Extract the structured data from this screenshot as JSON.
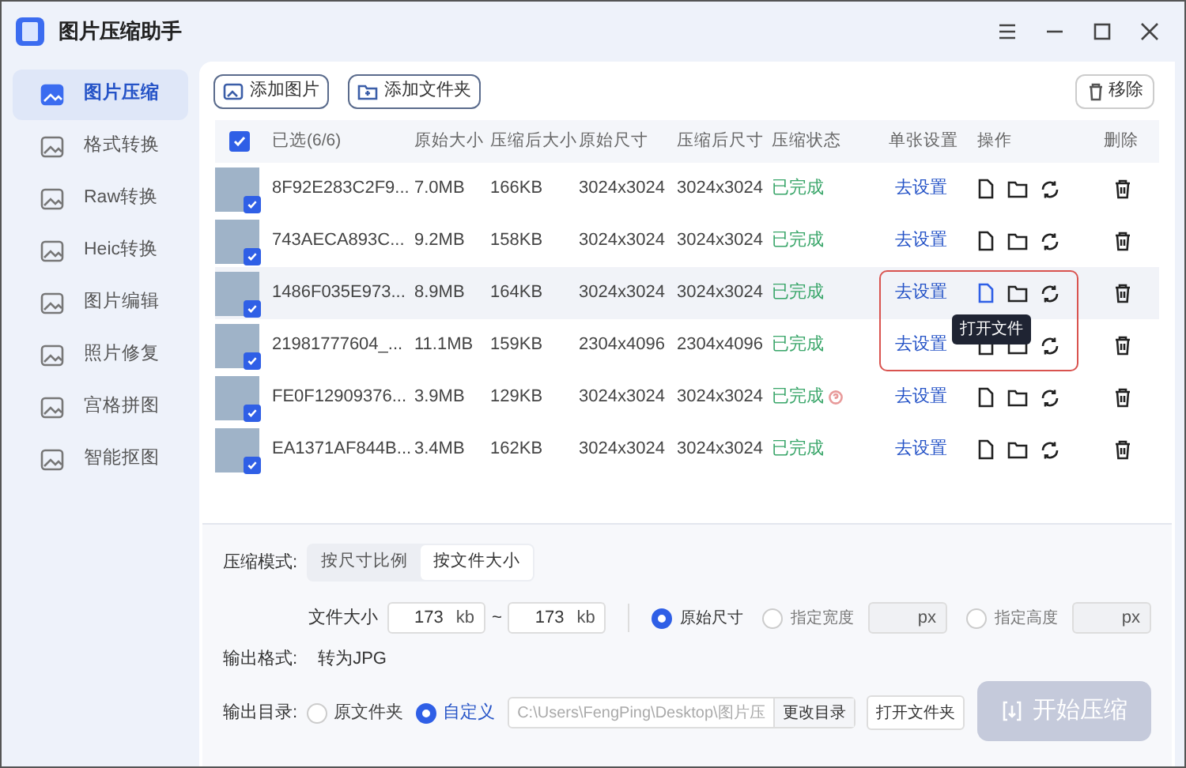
{
  "window": {
    "title": "图片压缩助手"
  },
  "sidebar": {
    "items": [
      {
        "label": "图片压缩",
        "selected": true
      },
      {
        "label": "格式转换",
        "selected": false
      },
      {
        "label": "Raw转换",
        "selected": false
      },
      {
        "label": "Heic转换",
        "selected": false
      },
      {
        "label": "图片编辑",
        "selected": false
      },
      {
        "label": "照片修复",
        "selected": false
      },
      {
        "label": "宫格拼图",
        "selected": false
      },
      {
        "label": "智能抠图",
        "selected": false
      }
    ]
  },
  "toolbar": {
    "add_image": "添加图片",
    "add_folder": "添加文件夹",
    "remove": "移除"
  },
  "table": {
    "all_checked": true,
    "columns": [
      "已选(6/6)",
      "原始大小",
      "压缩后大小",
      "原始尺寸",
      "压缩后尺寸",
      "压缩状态",
      "单张设置",
      "操作",
      "删除"
    ],
    "rows": [
      {
        "checked": true,
        "name": "8F92E283C2F9...",
        "original_size": "7.0MB",
        "compressed_size": "166KB",
        "original_dimensions": "3024x3024",
        "compressed_dimensions": "3024x3024",
        "status": "已完成",
        "status_info": false,
        "settings_link": "去设置",
        "hovered": false
      },
      {
        "checked": true,
        "name": "743AECA893C...",
        "original_size": "9.2MB",
        "compressed_size": "158KB",
        "original_dimensions": "3024x3024",
        "compressed_dimensions": "3024x3024",
        "status": "已完成",
        "status_info": false,
        "settings_link": "去设置",
        "hovered": false
      },
      {
        "checked": true,
        "name": "1486F035E973...",
        "original_size": "8.9MB",
        "compressed_size": "164KB",
        "original_dimensions": "3024x3024",
        "compressed_dimensions": "3024x3024",
        "status": "已完成",
        "status_info": false,
        "settings_link": "去设置",
        "hovered": true,
        "tooltip": "打开文件"
      },
      {
        "checked": true,
        "name": "21981777604_...",
        "original_size": "11.1MB",
        "compressed_size": "159KB",
        "original_dimensions": "2304x4096",
        "compressed_dimensions": "2304x4096",
        "status": "已完成",
        "status_info": false,
        "settings_link": "去设置",
        "hovered": false
      },
      {
        "checked": true,
        "name": "FE0F12909376...",
        "original_size": "3.9MB",
        "compressed_size": "129KB",
        "original_dimensions": "3024x3024",
        "compressed_dimensions": "3024x3024",
        "status": "已完成",
        "status_info": true,
        "settings_link": "去设置",
        "hovered": false
      },
      {
        "checked": true,
        "name": "EA1371AF844B...",
        "original_size": "3.4MB",
        "compressed_size": "162KB",
        "original_dimensions": "3024x3024",
        "compressed_dimensions": "3024x3024",
        "status": "已完成",
        "status_info": false,
        "settings_link": "去设置",
        "hovered": false
      }
    ]
  },
  "settings": {
    "mode_label": "压缩模式:",
    "mode_options": [
      {
        "label": "按尺寸比例",
        "selected": false
      },
      {
        "label": "按文件大小",
        "selected": true
      }
    ],
    "file_size_label": "文件大小",
    "min": {
      "value": "173",
      "unit": "kb"
    },
    "separator": "~",
    "max": {
      "value": "173",
      "unit": "kb"
    },
    "dimension_options": [
      {
        "label": "原始尺寸",
        "selected": true
      },
      {
        "label": "指定宽度",
        "selected": false,
        "unit": "px"
      },
      {
        "label": "指定高度",
        "selected": false,
        "unit": "px"
      }
    ],
    "output_format_label": "输出格式:",
    "output_format": "转为JPG",
    "output_dir_label": "输出目录:",
    "dir_options": [
      {
        "label": "原文件夹",
        "selected": false
      },
      {
        "label": "自定义",
        "selected": true
      }
    ],
    "path": "C:\\Users\\FengPing\\Desktop\\图片压",
    "change_dir_button": "更改目录",
    "open_folder_button": "打开文件夹"
  },
  "start_button": {
    "label": "开始压缩",
    "disabled": true
  }
}
